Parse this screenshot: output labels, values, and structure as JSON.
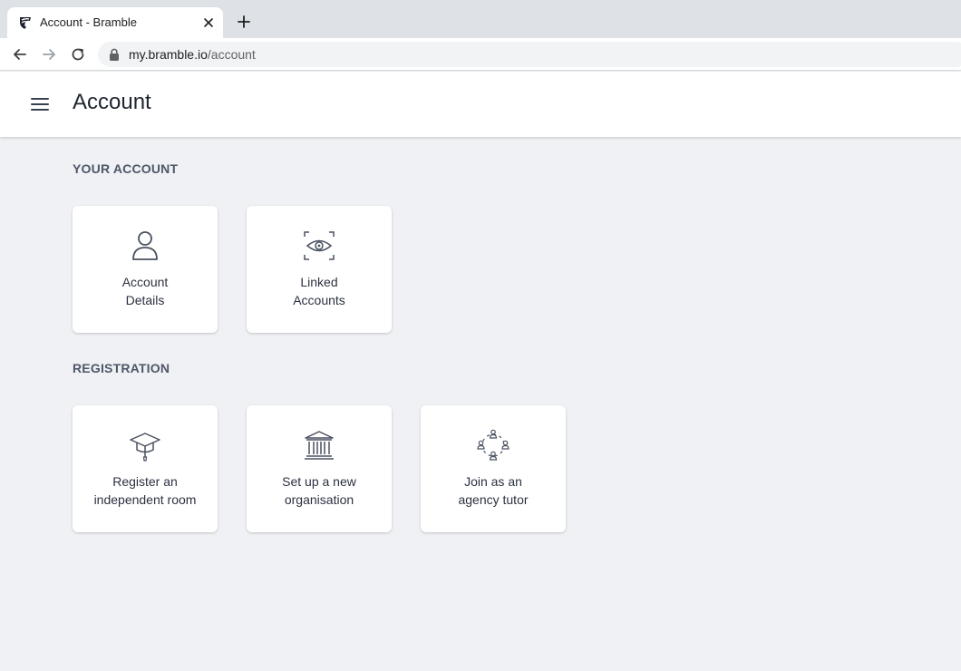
{
  "browser": {
    "tab_title": "Account - Bramble",
    "url_host": "my.bramble.io",
    "url_path": "/account"
  },
  "header": {
    "title": "Account"
  },
  "sections": [
    {
      "heading": "YOUR ACCOUNT",
      "cards": [
        {
          "label": "Account\nDetails",
          "icon": "person-icon"
        },
        {
          "label": "Linked\nAccounts",
          "icon": "eye-scan-icon"
        }
      ]
    },
    {
      "heading": "REGISTRATION",
      "cards": [
        {
          "label": "Register an\nindependent room",
          "icon": "graduation-cap-icon"
        },
        {
          "label": "Set up a new\norganisation",
          "icon": "institution-icon"
        },
        {
          "label": "Join as an\nagency tutor",
          "icon": "people-circle-icon"
        }
      ]
    }
  ],
  "colors": {
    "page_background": "#f0f1f4",
    "card_background": "#ffffff",
    "heading_text": "#4e5668",
    "title_text": "#1f2530",
    "icon_stroke": "#4a5160"
  }
}
